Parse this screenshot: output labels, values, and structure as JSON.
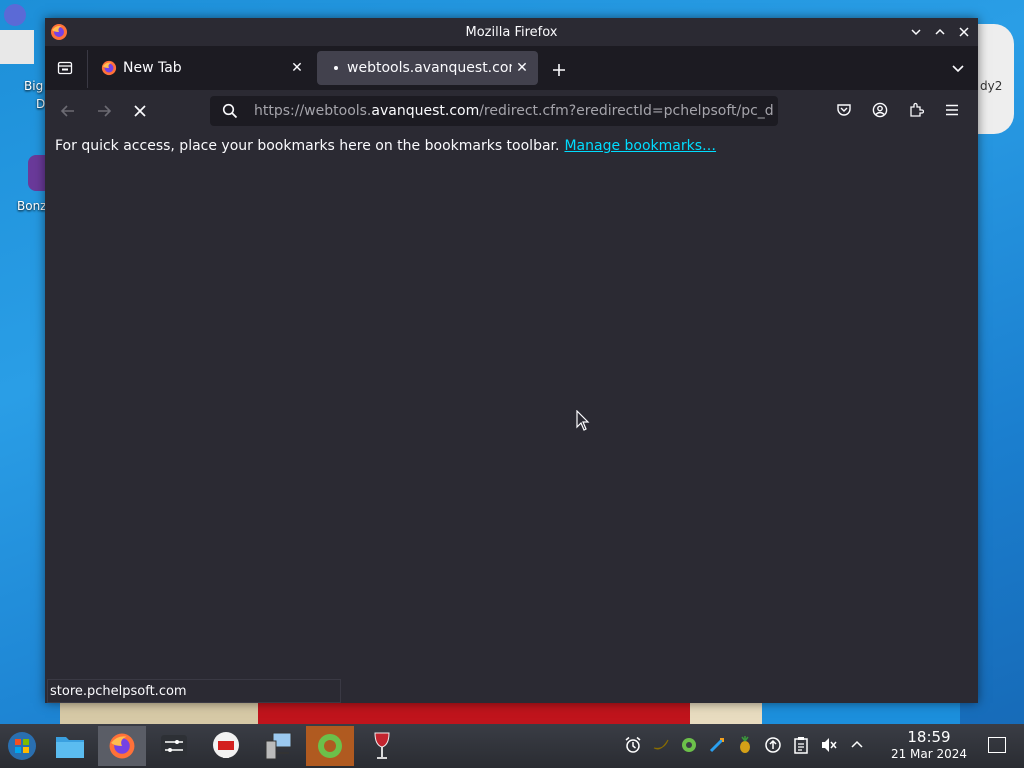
{
  "window": {
    "title": "Mozilla Firefox"
  },
  "tabs": [
    {
      "title": "New Tab",
      "icon": "firefox-icon",
      "active": false
    },
    {
      "title": "webtools.avanquest.com",
      "icon": "loading-dot-icon",
      "active": true
    }
  ],
  "navbar": {
    "url_prefix": "https://webtools.",
    "url_host": "avanquest.com",
    "url_suffix": "/redirect.cfm?eredirectId=pchelpsoft/pc_d"
  },
  "bookmarks_bar": {
    "message": "For quick access, place your bookmarks here on the bookmarks toolbar.",
    "link": "Manage bookmarks…"
  },
  "status_bar": {
    "text": "store.pchelpsoft.com"
  },
  "desktop": {
    "labels": [
      "Big",
      "D",
      "Bonz",
      "dy2"
    ]
  },
  "taskbar": {
    "time": "18:59",
    "date": "21 Mar 2024"
  },
  "colors": {
    "link": "#00ddff",
    "chrome_bg": "#2b2a33",
    "tab_active": "#42414d"
  }
}
